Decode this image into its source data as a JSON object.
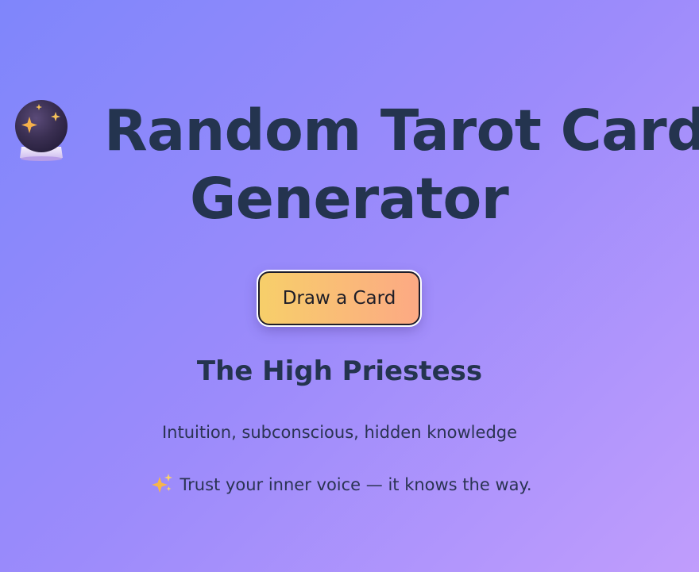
{
  "header": {
    "icon": "crystal-ball-icon",
    "title_line1": "Random Tarot Card",
    "title_line2": "Generator"
  },
  "actions": {
    "draw_button_label": "Draw a Card"
  },
  "result": {
    "card_name": "The High Priestess",
    "meaning": "Intuition, subconscious, hidden knowledge",
    "advice_icon": "sparkles-icon",
    "advice": "Trust your inner voice — it knows the way."
  },
  "colors": {
    "background_start": "#7f86fb",
    "background_end": "#c09dfc",
    "text": "#24344f",
    "button_start": "#f7cf6a",
    "button_end": "#fca984"
  }
}
